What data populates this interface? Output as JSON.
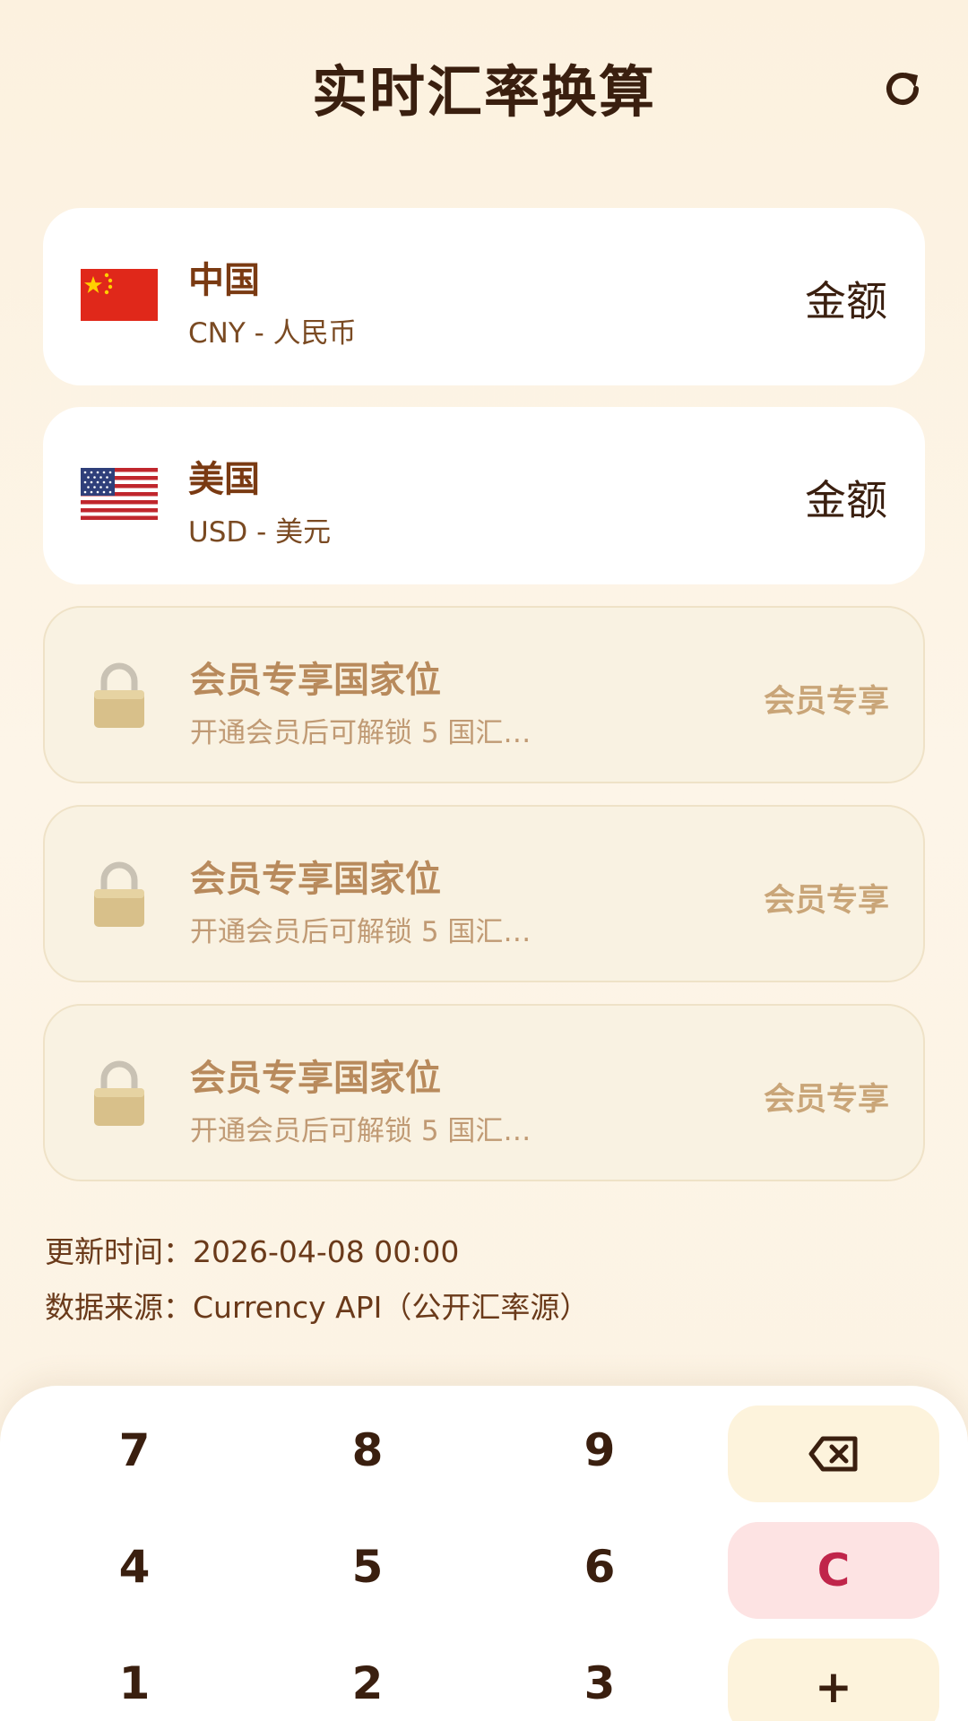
{
  "header": {
    "title": "实时汇率换算",
    "refresh_icon": "refresh-icon"
  },
  "currencies": [
    {
      "country": "中国",
      "currency": "CNY - 人民币",
      "amount": "金额",
      "flag": "cn-flag"
    },
    {
      "country": "美国",
      "currency": "USD - 美元",
      "amount": "金额",
      "flag": "us-flag"
    }
  ],
  "locked_slots": [
    {
      "title": "会员专享国家位",
      "desc": "开通会员后可解锁 5 国汇…",
      "tag": "会员专享"
    },
    {
      "title": "会员专享国家位",
      "desc": "开通会员后可解锁 5 国汇…",
      "tag": "会员专享"
    },
    {
      "title": "会员专享国家位",
      "desc": "开通会员后可解锁 5 国汇…",
      "tag": "会员专享"
    }
  ],
  "info": {
    "update_time": "更新时间：2026-04-08 00:00",
    "data_source": "数据来源：Currency API（公开汇率源）"
  },
  "keypad": {
    "keys": [
      "7",
      "8",
      "9",
      "4",
      "5",
      "6",
      "1",
      "2",
      "3"
    ],
    "backspace_icon": "backspace-icon",
    "clear_label": "C",
    "plus_label": "+"
  },
  "colors": {
    "title": "#3a1f0f",
    "clear_key_bg": "#fde3e3",
    "clear_key_text": "#c0254a",
    "aux_key_bg": "#fdf3dc",
    "member_tag": "#c9a578"
  }
}
